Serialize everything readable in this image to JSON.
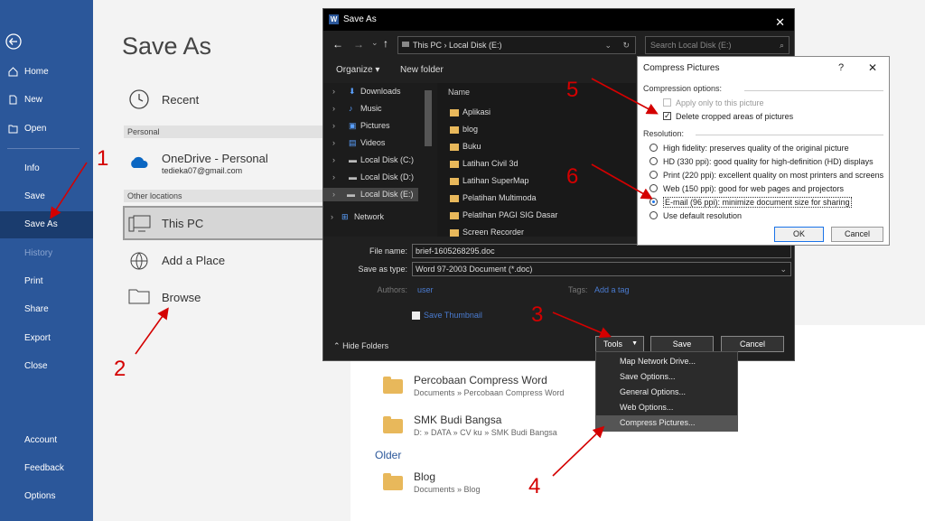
{
  "nav": {
    "items": [
      {
        "label": "Home"
      },
      {
        "label": "New"
      },
      {
        "label": "Open"
      },
      {
        "label": "Info"
      },
      {
        "label": "Save"
      },
      {
        "label": "Save As"
      },
      {
        "label": "History"
      },
      {
        "label": "Print"
      },
      {
        "label": "Share"
      },
      {
        "label": "Export"
      },
      {
        "label": "Close"
      },
      {
        "label": "Account"
      },
      {
        "label": "Feedback"
      },
      {
        "label": "Options"
      }
    ]
  },
  "backstage": {
    "title": "Save As",
    "recent": "Recent",
    "personal_header": "Personal",
    "onedrive": "OneDrive - Personal",
    "email": "tedieka07@gmail.com",
    "other_header": "Other locations",
    "this_pc": "This PC",
    "add_place": "Add a Place",
    "browse": "Browse",
    "older": "Older",
    "recent_items": [
      {
        "name": "Percobaan Compress Word",
        "path": "Documents » Percobaan Compress Word"
      },
      {
        "name": "SMK Budi Bangsa",
        "path": "D: » DATA » CV ku » SMK Budi Bangsa"
      },
      {
        "name": "Blog",
        "path": "Documents » Blog"
      }
    ]
  },
  "dialog": {
    "title": "Save As",
    "path": [
      "This PC",
      "Local Disk (E:)"
    ],
    "search_placeholder": "Search Local Disk (E:)",
    "organize": "Organize ▾",
    "new_folder": "New folder",
    "column_name": "Name",
    "tree": [
      "Downloads",
      "Music",
      "Pictures",
      "Videos",
      "Local Disk (C:)",
      "Local Disk (D:)",
      "Local Disk (E:)",
      "Network"
    ],
    "files": [
      "Aplikasi",
      "blog",
      "Buku",
      "Latihan Civil 3d",
      "Latihan SuperMap",
      "Pelatihan Multimoda",
      "Pelatihan PAGI SIG Dasar",
      "Screen Recorder"
    ],
    "file_name_label": "File name:",
    "file_name": "brief-1605268295.doc",
    "save_type_label": "Save as type:",
    "save_type": "Word 97-2003 Document (*.doc)",
    "authors_label": "Authors:",
    "authors": "user",
    "tags_label": "Tags:",
    "tags": "Add a tag",
    "thumbnail": "Save Thumbnail",
    "hide_folders": "Hide Folders",
    "tools": "Tools",
    "save": "Save",
    "cancel": "Cancel"
  },
  "tools_menu": [
    "Map Network Drive...",
    "Save Options...",
    "General Options...",
    "Web Options...",
    "Compress Pictures..."
  ],
  "compress": {
    "title": "Compress Pictures",
    "help": "?",
    "compression_header": "Compression options:",
    "apply_only": "Apply only to this picture",
    "delete_cropped": "Delete cropped areas of pictures",
    "resolution_header": "Resolution:",
    "options": [
      "High fidelity: preserves quality of the original picture",
      "HD (330 ppi): good quality for high-definition (HD) displays",
      "Print (220 ppi): excellent quality on most printers and screens",
      "Web (150 ppi): good for web pages and projectors",
      "E-mail (96 ppi): minimize document size for sharing",
      "Use default resolution"
    ],
    "selected_index": 4,
    "ok": "OK",
    "cancel": "Cancel"
  },
  "annotations": [
    "1",
    "2",
    "3",
    "4",
    "5",
    "6"
  ],
  "colors": {
    "nav_bg": "#2b579a",
    "annotation": "#d40000"
  }
}
